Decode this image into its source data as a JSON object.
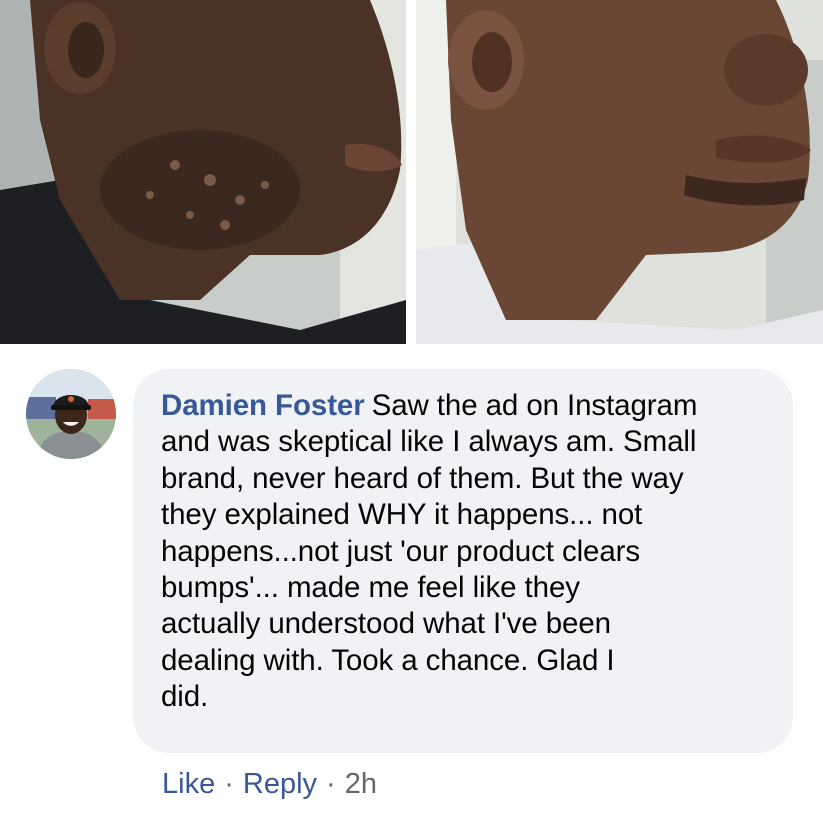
{
  "comment": {
    "author": "Damien Foster",
    "lines": [
      "Saw the ad on Instagram",
      "and was skeptical like I always am. Small",
      "brand, never heard of them. But the way",
      "they explained WHY it happens... not",
      "happens...not just 'our product clears",
      "bumps'... made me feel like they",
      "actually understood what I've been",
      "dealing with. Took a chance. Glad I",
      "did."
    ]
  },
  "actions": {
    "like_label": "Like",
    "separator": "·",
    "reply_label": "Reply",
    "timestamp": "2h"
  },
  "colors": {
    "author_blue": "#385898",
    "bubble_bg": "#f0f2f5",
    "meta_gray": "#65676b"
  }
}
